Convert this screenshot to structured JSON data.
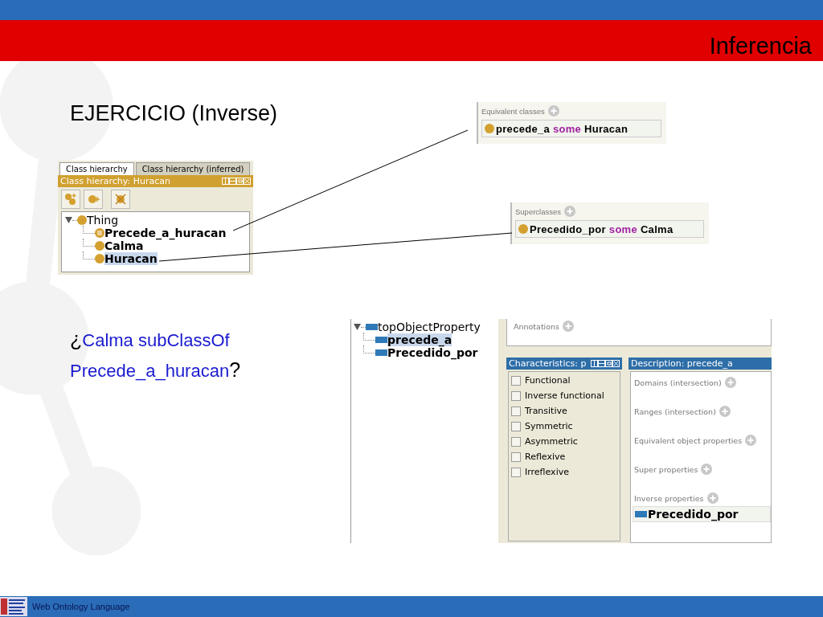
{
  "header": {
    "title": "Inferencia"
  },
  "exercise_title": "EJERCICIO (Inverse)",
  "question": {
    "open": "¿",
    "text": "Calma subClassOf Precede_a_huracan",
    "close": "?"
  },
  "class_hierarchy": {
    "tabs": [
      {
        "label": "Class hierarchy",
        "selected": true
      },
      {
        "label": "Class hierarchy (inferred)",
        "selected": false
      }
    ],
    "title": "Class hierarchy: Huracan",
    "tree": {
      "label": "Thing",
      "kind": "primitive",
      "expanded": true,
      "selected": false,
      "children": [
        {
          "label": "Precede_a_huracan",
          "kind": "defined",
          "selected": false
        },
        {
          "label": "Calma",
          "kind": "primitive",
          "selected": false
        },
        {
          "label": "Huracan",
          "kind": "primitive",
          "selected": true
        }
      ]
    }
  },
  "equivalent_classes": {
    "label": "Equivalent classes",
    "expression": [
      {
        "text": "precede_a",
        "kind": "entity"
      },
      {
        "text": "some",
        "kind": "keyword"
      },
      {
        "text": "Huracan",
        "kind": "entity"
      }
    ]
  },
  "superclasses": {
    "label": "Superclasses",
    "expression": [
      {
        "text": "Precedido_por",
        "kind": "entity"
      },
      {
        "text": "some",
        "kind": "keyword"
      },
      {
        "text": "Calma",
        "kind": "entity"
      }
    ]
  },
  "property_view": {
    "tree": {
      "label": "topObjectProperty",
      "expanded": true,
      "selected": false,
      "children": [
        {
          "label": "precede_a",
          "selected": true
        },
        {
          "label": "Precedido_por",
          "selected": false
        }
      ]
    },
    "annotations": {
      "label": "Annotations"
    },
    "characteristics": {
      "title": "Characteristics: p",
      "items": [
        {
          "label": "Functional",
          "checked": false
        },
        {
          "label": "Inverse functional",
          "checked": false
        },
        {
          "label": "Transitive",
          "checked": false
        },
        {
          "label": "Symmetric",
          "checked": false
        },
        {
          "label": "Asymmetric",
          "checked": false
        },
        {
          "label": "Reflexive",
          "checked": false
        },
        {
          "label": "Irreflexive",
          "checked": false
        }
      ]
    },
    "description": {
      "title": "Description: precede_a",
      "sections": [
        {
          "label": "Domains (intersection)"
        },
        {
          "label": "Ranges (intersection)"
        },
        {
          "label": "Equivalent object properties"
        },
        {
          "label": "Super properties"
        },
        {
          "label": "Inverse properties",
          "items": [
            "Precedido_por"
          ]
        }
      ]
    }
  },
  "footer": {
    "text": "Web Ontology Language"
  }
}
